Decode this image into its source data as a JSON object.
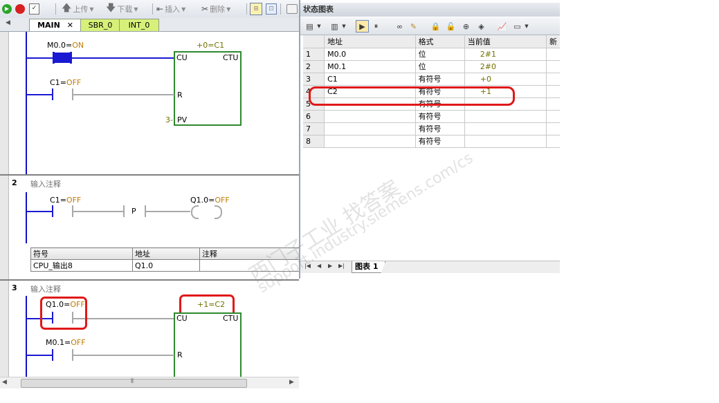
{
  "toolbar": {
    "upload": "上传",
    "download": "下载",
    "insert": "插入",
    "delete": "删除"
  },
  "tabs": [
    {
      "label": "MAIN"
    },
    {
      "label": "SBR_0"
    },
    {
      "label": "INT_0"
    }
  ],
  "network1": {
    "contact1": {
      "addr": "M0.0",
      "eq": "=",
      "state": "ON"
    },
    "counter_value": "+0=C1",
    "cu": "CU",
    "ctu": "CTU",
    "contact2": {
      "addr": "C1",
      "eq": "=",
      "state": "OFF"
    },
    "r": "R",
    "pv_value": "3-",
    "pv": "PV"
  },
  "network2": {
    "number": "2",
    "comment": "输入注释",
    "contact": {
      "addr": "C1",
      "eq": "=",
      "state": "OFF"
    },
    "p": "P",
    "coil": {
      "addr": "Q1.0",
      "eq": "=",
      "state": "OFF"
    },
    "symbols": {
      "headers": [
        "符号",
        "地址",
        "注释"
      ],
      "rows": [
        [
          "CPU_输出8",
          "Q1.0",
          ""
        ]
      ]
    }
  },
  "network3": {
    "number": "3",
    "comment": "输入注释",
    "contact1": {
      "addr": "Q1.0",
      "eq": "=",
      "state": "OFF"
    },
    "counter_value": "+1=C2",
    "cu": "CU",
    "ctu": "CTU",
    "contact2": {
      "addr": "M0.1",
      "eq": "=",
      "state": "OFF"
    },
    "r": "R"
  },
  "status_chart": {
    "title": "状态图表",
    "headers": [
      "",
      "地址",
      "格式",
      "当前值",
      "新"
    ],
    "rows": [
      {
        "n": "1",
        "addr": "M0.0",
        "fmt": "位",
        "val": "2#1"
      },
      {
        "n": "2",
        "addr": "M0.1",
        "fmt": "位",
        "val": "2#0"
      },
      {
        "n": "3",
        "addr": "C1",
        "fmt": "有符号",
        "val": "+0"
      },
      {
        "n": "4",
        "addr": "C2",
        "fmt": "有符号",
        "val": "+1"
      },
      {
        "n": "5",
        "addr": "",
        "fmt": "有符号",
        "val": ""
      },
      {
        "n": "6",
        "addr": "",
        "fmt": "有符号",
        "val": ""
      },
      {
        "n": "7",
        "addr": "",
        "fmt": "有符号",
        "val": ""
      },
      {
        "n": "8",
        "addr": "",
        "fmt": "有符号",
        "val": ""
      }
    ],
    "sheet_tab": "图表 1"
  },
  "watermark": {
    "line1": "西门子工业  找答案",
    "line2": "support.industry.siemens.com/cs"
  },
  "colors": {
    "rail": "#1a1ad2",
    "box": "#2d8a2d",
    "highlight": "#e01818",
    "tab_other": "#d7f07a"
  }
}
